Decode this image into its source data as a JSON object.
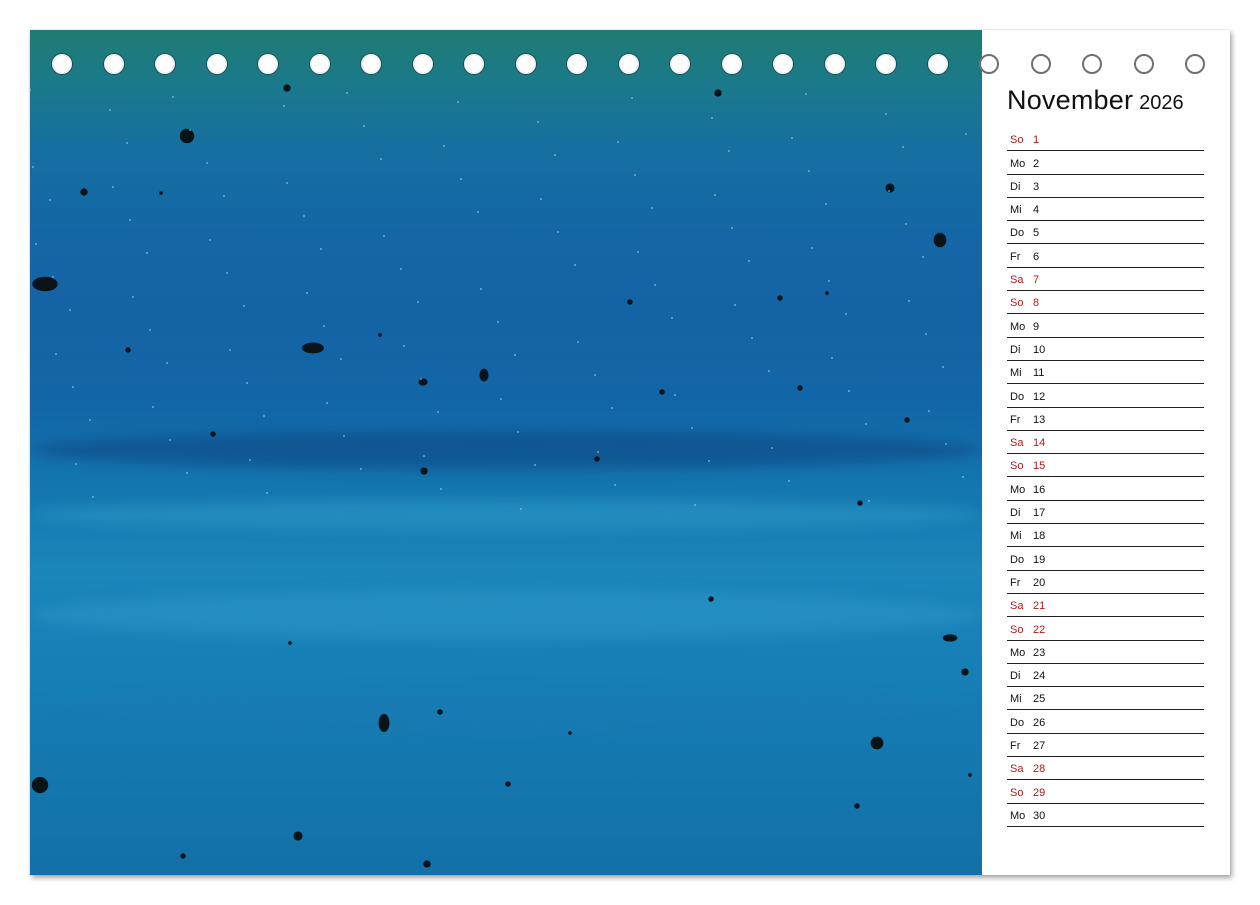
{
  "calendar": {
    "month": "November",
    "year": "2026",
    "weekend_color": "#b11a1a",
    "days": [
      {
        "weekday": "So",
        "day": "1",
        "weekend": true
      },
      {
        "weekday": "Mo",
        "day": "2",
        "weekend": false
      },
      {
        "weekday": "Di",
        "day": "3",
        "weekend": false
      },
      {
        "weekday": "Mi",
        "day": "4",
        "weekend": false
      },
      {
        "weekday": "Do",
        "day": "5",
        "weekend": false
      },
      {
        "weekday": "Fr",
        "day": "6",
        "weekend": false
      },
      {
        "weekday": "Sa",
        "day": "7",
        "weekend": true
      },
      {
        "weekday": "So",
        "day": "8",
        "weekend": true
      },
      {
        "weekday": "Mo",
        "day": "9",
        "weekend": false
      },
      {
        "weekday": "Di",
        "day": "10",
        "weekend": false
      },
      {
        "weekday": "Mi",
        "day": "11",
        "weekend": false
      },
      {
        "weekday": "Do",
        "day": "12",
        "weekend": false
      },
      {
        "weekday": "Fr",
        "day": "13",
        "weekend": false
      },
      {
        "weekday": "Sa",
        "day": "14",
        "weekend": true
      },
      {
        "weekday": "So",
        "day": "15",
        "weekend": true
      },
      {
        "weekday": "Mo",
        "day": "16",
        "weekend": false
      },
      {
        "weekday": "Di",
        "day": "17",
        "weekend": false
      },
      {
        "weekday": "Mi",
        "day": "18",
        "weekend": false
      },
      {
        "weekday": "Do",
        "day": "19",
        "weekend": false
      },
      {
        "weekday": "Fr",
        "day": "20",
        "weekend": false
      },
      {
        "weekday": "Sa",
        "day": "21",
        "weekend": true
      },
      {
        "weekday": "So",
        "day": "22",
        "weekend": true
      },
      {
        "weekday": "Mo",
        "day": "23",
        "weekend": false
      },
      {
        "weekday": "Di",
        "day": "24",
        "weekend": false
      },
      {
        "weekday": "Mi",
        "day": "25",
        "weekend": false
      },
      {
        "weekday": "Do",
        "day": "26",
        "weekend": false
      },
      {
        "weekday": "Fr",
        "day": "27",
        "weekend": false
      },
      {
        "weekday": "Sa",
        "day": "28",
        "weekend": true
      },
      {
        "weekday": "So",
        "day": "29",
        "weekend": true
      },
      {
        "weekday": "Mo",
        "day": "30",
        "weekend": false
      }
    ]
  },
  "binding": {
    "ring_count": 23,
    "rings_over_photo": 18
  },
  "photo": {
    "description_colors": [
      "#1f7c72",
      "#1466a6",
      "#1a86ba",
      "#1370a8"
    ]
  }
}
